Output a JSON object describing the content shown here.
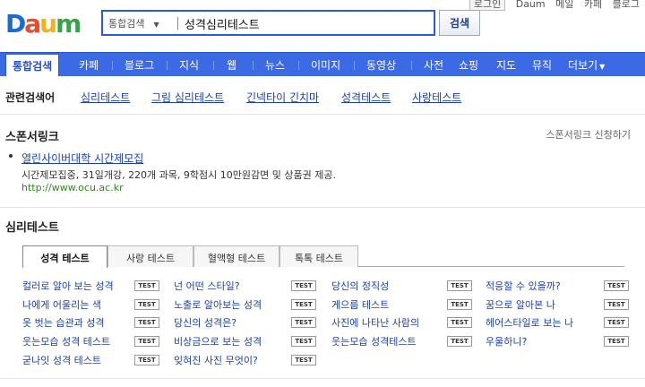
{
  "top_links": {
    "login": "로그인",
    "items": [
      "Daum",
      "메일",
      "카페",
      "블로그"
    ]
  },
  "logo": {
    "text_parts": [
      "D",
      "a",
      "u",
      "m"
    ],
    "colors": [
      "#1a6bd6",
      "#e84c2c",
      "#f2b21a",
      "#37a34a"
    ]
  },
  "search": {
    "category": "통합검색",
    "query": "성격심리테스트",
    "button_label": "검색"
  },
  "nav": {
    "accent": "#3c6ae4",
    "items": [
      "통합검색",
      "카페",
      "블로그",
      "지식",
      "웹",
      "뉴스",
      "이미지",
      "동영상",
      "사전",
      "쇼핑",
      "지도",
      "뮤직",
      "더보기"
    ]
  },
  "related": {
    "label": "관련검색어",
    "items": [
      "심리테스트",
      "그림 심리테스트",
      "긴넥타이 긴치마",
      "성격테스트",
      "사랑테스트"
    ]
  },
  "sponsor": {
    "title": "스폰서링크",
    "apply": "스폰서링크 신청하기",
    "ad": {
      "title": "열린사이버대학 시간제모집",
      "desc": "시간제모집중, 31일개강, 220개 과목, 9학점시 10만원감면 및 상품권 제공.",
      "url": "http://www.ocu.ac.kr"
    }
  },
  "psych": {
    "title": "심리테스트",
    "tabs": [
      "성격 테스트",
      "사랑 테스트",
      "혈액형 테스트",
      "톡톡 테스트"
    ],
    "badge": "TEST",
    "columns": [
      [
        "컬러로 알아 보는 성격",
        "나에게 어울리는 색",
        "옷 벗는 습관과 성격",
        "웃는모습 성격 테스트",
        "굳나잇 성격 테스트"
      ],
      [
        "넌 어떤 스타일?",
        "노출로 알아보는 성격",
        "당신의 성격은?",
        "비상금으로 보는 성격",
        "잊혀진 사진 무엇이?"
      ],
      [
        "당신의 정직성",
        "게으름 테스트",
        "사진에 나타난 사람의",
        "웃는모습 성격테스트"
      ],
      [
        "적응할 수 있을까?",
        "꿈으로 알아본 나",
        "헤어스타일로 보는 나",
        "우울하니?"
      ]
    ]
  }
}
